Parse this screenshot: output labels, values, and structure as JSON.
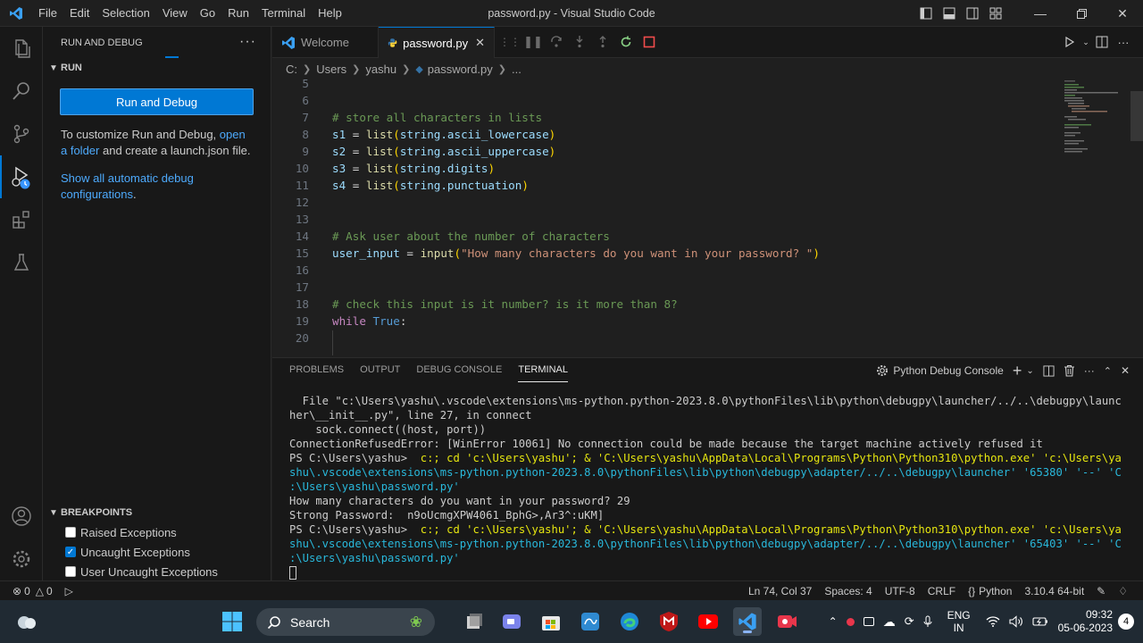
{
  "window": {
    "title": "password.py - Visual Studio Code",
    "menu": [
      "File",
      "Edit",
      "Selection",
      "View",
      "Go",
      "Run",
      "Terminal",
      "Help"
    ]
  },
  "sidebar": {
    "header": "RUN AND DEBUG",
    "run_section": "RUN",
    "run_button": "Run and Debug",
    "customize_text_1": "To customize Run and Debug, ",
    "customize_link": "open a folder",
    "customize_text_2": " and create a launch.json file.",
    "show_all_link": "Show all automatic debug configurations",
    "show_all_suffix": ".",
    "breakpoints_header": "BREAKPOINTS",
    "breakpoints": [
      {
        "label": "Raised Exceptions",
        "checked": false
      },
      {
        "label": "Uncaught Exceptions",
        "checked": true
      },
      {
        "label": "User Uncaught Exceptions",
        "checked": false
      }
    ]
  },
  "tabs": [
    {
      "label": "Welcome",
      "active": false
    },
    {
      "label": "password.py",
      "active": true
    }
  ],
  "breadcrumb": [
    "C:",
    "Users",
    "yashu",
    "password.py",
    "..."
  ],
  "code": {
    "line_numbers": [
      "5",
      "6",
      "7",
      "8",
      "9",
      "10",
      "11",
      "12",
      "13",
      "14",
      "15",
      "16",
      "17",
      "18",
      "19",
      "20"
    ],
    "l7": "# store all characters in lists",
    "l8_var": "s1",
    "l8_fn": "list",
    "l8_arg": "string.ascii_lowercase",
    "l9_var": "s2",
    "l9_fn": "list",
    "l9_arg": "string.ascii_uppercase",
    "l10_var": "s3",
    "l10_fn": "list",
    "l10_arg": "string.digits",
    "l11_var": "s4",
    "l11_fn": "list",
    "l11_arg": "string.punctuation",
    "l14": "# Ask user about the number of characters",
    "l15_var": "user_input",
    "l15_fn": "input",
    "l15_str": "\"How many characters do you want in your password? \"",
    "l18": "# check this input is it number? is it more than 8?",
    "l19_kw": "while",
    "l19_val": "True"
  },
  "panel": {
    "tabs": [
      "PROBLEMS",
      "OUTPUT",
      "DEBUG CONSOLE",
      "TERMINAL"
    ],
    "active_tab": "TERMINAL",
    "terminal_name": "Python Debug Console",
    "lines": [
      "  File \"c:\\Users\\yashu\\.vscode\\extensions\\ms-python.python-2023.8.0\\pythonFiles\\lib\\python\\debugpy\\launcher/../..\\debugpy\\launc",
      "her\\__init__.py\", line 27, in connect",
      "    sock.connect((host, port))",
      "ConnectionRefusedError: [WinError 10061] No connection could be made because the target machine actively refused it"
    ],
    "ps1_prompt": "PS C:\\Users\\yashu> ",
    "ps1_cmd": " c:; cd 'c:\\Users\\yashu'; & 'C:\\Users\\yashu\\AppData\\Local\\Programs\\Python\\Python310\\python.exe' 'c:\\Users\\ya",
    "ps1_cont1": "shu\\.vscode\\extensions\\ms-python.python-2023.8.0\\pythonFiles\\lib\\python\\debugpy\\adapter/../..\\debugpy\\launcher' '65380' '--' 'C",
    "ps1_cont2": ":\\Users\\yashu\\password.py'",
    "out1": "How many characters do you want in your password? 29",
    "out2": "Strong Password:  n9oUcmgXPW4061_BphG>,Ar3^:uKM]",
    "ps2_prompt": "PS C:\\Users\\yashu> ",
    "ps2_cmd": " c:; cd 'c:\\Users\\yashu'; & 'C:\\Users\\yashu\\AppData\\Local\\Programs\\Python\\Python310\\python.exe' 'c:\\Users\\ya",
    "ps2_cont1": "shu\\.vscode\\extensions\\ms-python.python-2023.8.0\\pythonFiles\\lib\\python\\debugpy\\adapter/../..\\debugpy\\launcher' '65403' '--' 'C",
    "ps2_cont2": ":\\Users\\yashu\\password.py'"
  },
  "statusbar": {
    "errors": "0",
    "warnings": "0",
    "position": "Ln 74, Col 37",
    "spaces": "Spaces: 4",
    "encoding": "UTF-8",
    "eol": "CRLF",
    "language": "Python",
    "interpreter": "3.10.4 64-bit"
  },
  "taskbar": {
    "search": "Search",
    "lang1": "ENG",
    "lang2": "IN",
    "time": "09:32",
    "date": "05-06-2023",
    "notifications": "4"
  },
  "colors": {
    "accent": "#0078d4",
    "link": "#4daafc",
    "comment": "#6a9955",
    "string": "#ce9178"
  }
}
